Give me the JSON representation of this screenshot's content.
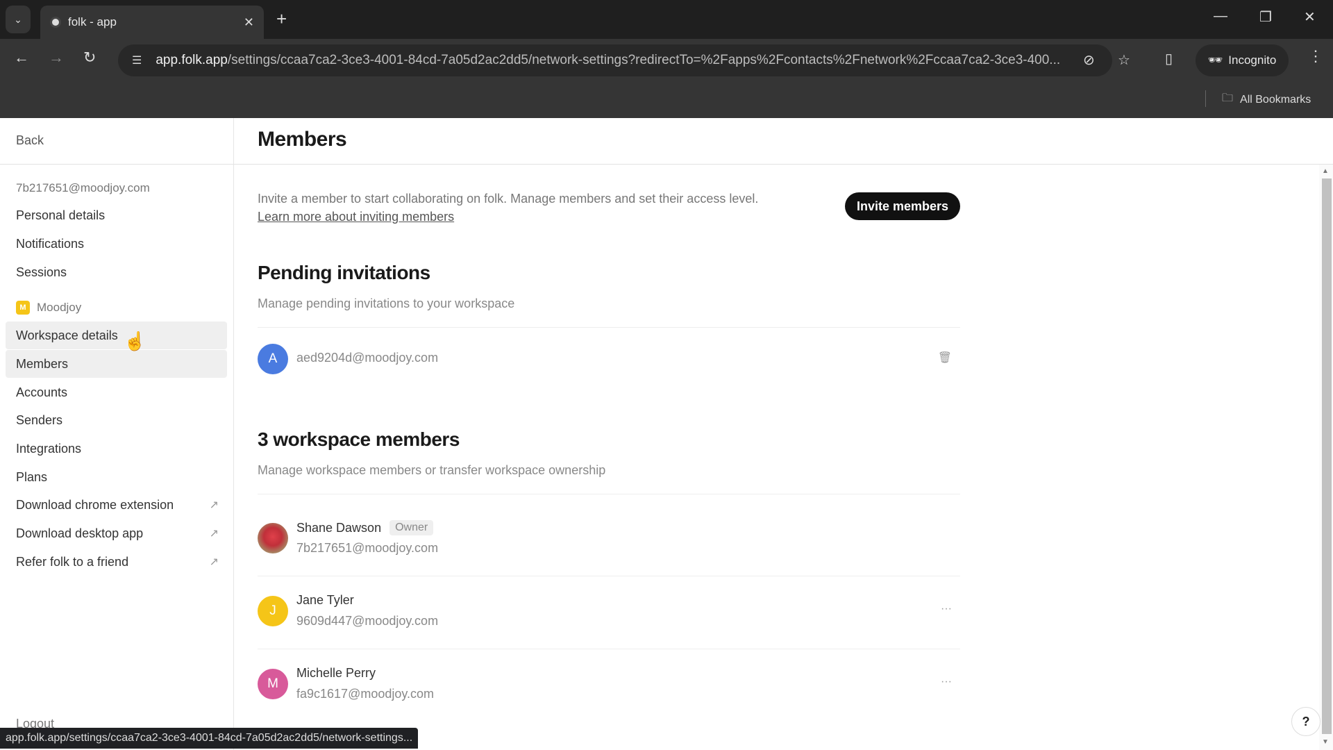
{
  "browser": {
    "tab_title": "folk - app",
    "url_host": "app.folk.app",
    "url_path": "/settings/ccaa7ca2-3ce3-4001-84cd-7a05d2ac2dd5/network-settings?redirectTo=%2Fapps%2Fcontacts%2Fnetwork%2Fccaa7ca2-3ce3-400...",
    "incognito_label": "Incognito",
    "bookmarks_label": "All Bookmarks",
    "status_url": "app.folk.app/settings/ccaa7ca2-3ce3-4001-84cd-7a05d2ac2dd5/network-settings..."
  },
  "sidebar": {
    "back_label": "Back",
    "account_email": "7b217651@moodjoy.com",
    "personal_items": [
      {
        "label": "Personal details"
      },
      {
        "label": "Notifications"
      },
      {
        "label": "Sessions"
      }
    ],
    "workspace": {
      "badge": "M",
      "name": "Moodjoy",
      "badge_color": "#f5c518"
    },
    "workspace_items": [
      {
        "label": "Workspace details",
        "hovered": true
      },
      {
        "label": "Members",
        "active": true
      },
      {
        "label": "Accounts"
      },
      {
        "label": "Senders"
      },
      {
        "label": "Integrations"
      },
      {
        "label": "Plans"
      }
    ],
    "external_items": [
      {
        "label": "Download chrome extension",
        "icon": "external-link-icon"
      },
      {
        "label": "Download desktop app",
        "icon": "external-link-icon"
      },
      {
        "label": "Refer folk to a friend",
        "icon": "external-link-icon"
      }
    ],
    "logout_label": "Logout"
  },
  "main": {
    "title": "Members",
    "intro_text": "Invite a member to start collaborating on folk. Manage members and set their access level.",
    "learn_more_link": "Learn more about inviting members",
    "invite_button": "Invite members",
    "pending": {
      "title": "Pending invitations",
      "subtitle": "Manage pending invitations to your workspace",
      "items": [
        {
          "initial": "A",
          "email": "aed9204d@moodjoy.com",
          "color": "#4a7be0"
        }
      ]
    },
    "members": {
      "title": "3 workspace members",
      "subtitle": "Manage workspace members or transfer workspace ownership",
      "items": [
        {
          "name": "Shane Dawson",
          "badge": "Owner",
          "email": "7b217651@moodjoy.com",
          "avatar": "photo"
        },
        {
          "name": "Jane Tyler",
          "email": "9609d447@moodjoy.com",
          "initial": "J",
          "color": "#f5c518"
        },
        {
          "name": "Michelle Perry",
          "email": "fa9c1617@moodjoy.com",
          "initial": "M",
          "color": "#d85a9a"
        }
      ]
    },
    "help_label": "?"
  }
}
